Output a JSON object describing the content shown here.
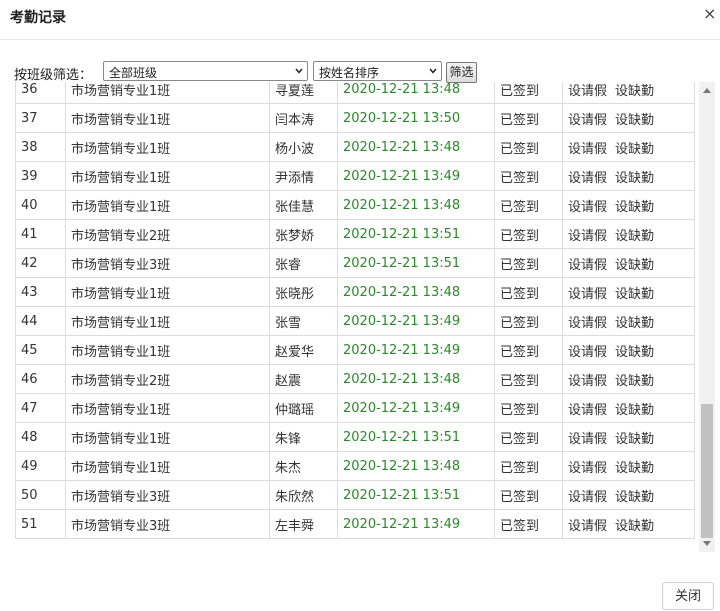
{
  "dialog": {
    "title": "考勤记录",
    "close_glyph": "×"
  },
  "filter": {
    "label": "按班级筛选：",
    "class_select_value": "全部班级",
    "sort_select_value": "按姓名排序",
    "filter_button": "筛选"
  },
  "actions": {
    "leave": "设请假",
    "absent": "设缺勤"
  },
  "rows": [
    {
      "no": "36",
      "class": "市场营销专业1班",
      "name": "寻夏莲",
      "time": "2020-12-21 13:48",
      "status": "已签到"
    },
    {
      "no": "37",
      "class": "市场营销专业1班",
      "name": "闫本涛",
      "time": "2020-12-21 13:50",
      "status": "已签到"
    },
    {
      "no": "38",
      "class": "市场营销专业1班",
      "name": "杨小波",
      "time": "2020-12-21 13:48",
      "status": "已签到"
    },
    {
      "no": "39",
      "class": "市场营销专业1班",
      "name": "尹添情",
      "time": "2020-12-21 13:49",
      "status": "已签到"
    },
    {
      "no": "40",
      "class": "市场营销专业1班",
      "name": "张佳慧",
      "time": "2020-12-21 13:48",
      "status": "已签到"
    },
    {
      "no": "41",
      "class": "市场营销专业2班",
      "name": "张梦娇",
      "time": "2020-12-21 13:51",
      "status": "已签到"
    },
    {
      "no": "42",
      "class": "市场营销专业3班",
      "name": "张睿",
      "time": "2020-12-21 13:51",
      "status": "已签到"
    },
    {
      "no": "43",
      "class": "市场营销专业1班",
      "name": "张晓彤",
      "time": "2020-12-21 13:48",
      "status": "已签到"
    },
    {
      "no": "44",
      "class": "市场营销专业1班",
      "name": "张雪",
      "time": "2020-12-21 13:49",
      "status": "已签到"
    },
    {
      "no": "45",
      "class": "市场营销专业1班",
      "name": "赵爱华",
      "time": "2020-12-21 13:49",
      "status": "已签到"
    },
    {
      "no": "46",
      "class": "市场营销专业2班",
      "name": "赵震",
      "time": "2020-12-21 13:48",
      "status": "已签到"
    },
    {
      "no": "47",
      "class": "市场营销专业1班",
      "name": "仲璐瑶",
      "time": "2020-12-21 13:49",
      "status": "已签到"
    },
    {
      "no": "48",
      "class": "市场营销专业1班",
      "name": "朱锋",
      "time": "2020-12-21 13:51",
      "status": "已签到"
    },
    {
      "no": "49",
      "class": "市场营销专业1班",
      "name": "朱杰",
      "time": "2020-12-21 13:48",
      "status": "已签到"
    },
    {
      "no": "50",
      "class": "市场营销专业3班",
      "name": "朱欣然",
      "time": "2020-12-21 13:51",
      "status": "已签到"
    },
    {
      "no": "51",
      "class": "市场营销专业3班",
      "name": "左丰舜",
      "time": "2020-12-21 13:49",
      "status": "已签到"
    }
  ],
  "footer": {
    "close_button": "关闭"
  },
  "colors": {
    "time_text": "#2a8a2a",
    "border": "#dcdcdc"
  }
}
